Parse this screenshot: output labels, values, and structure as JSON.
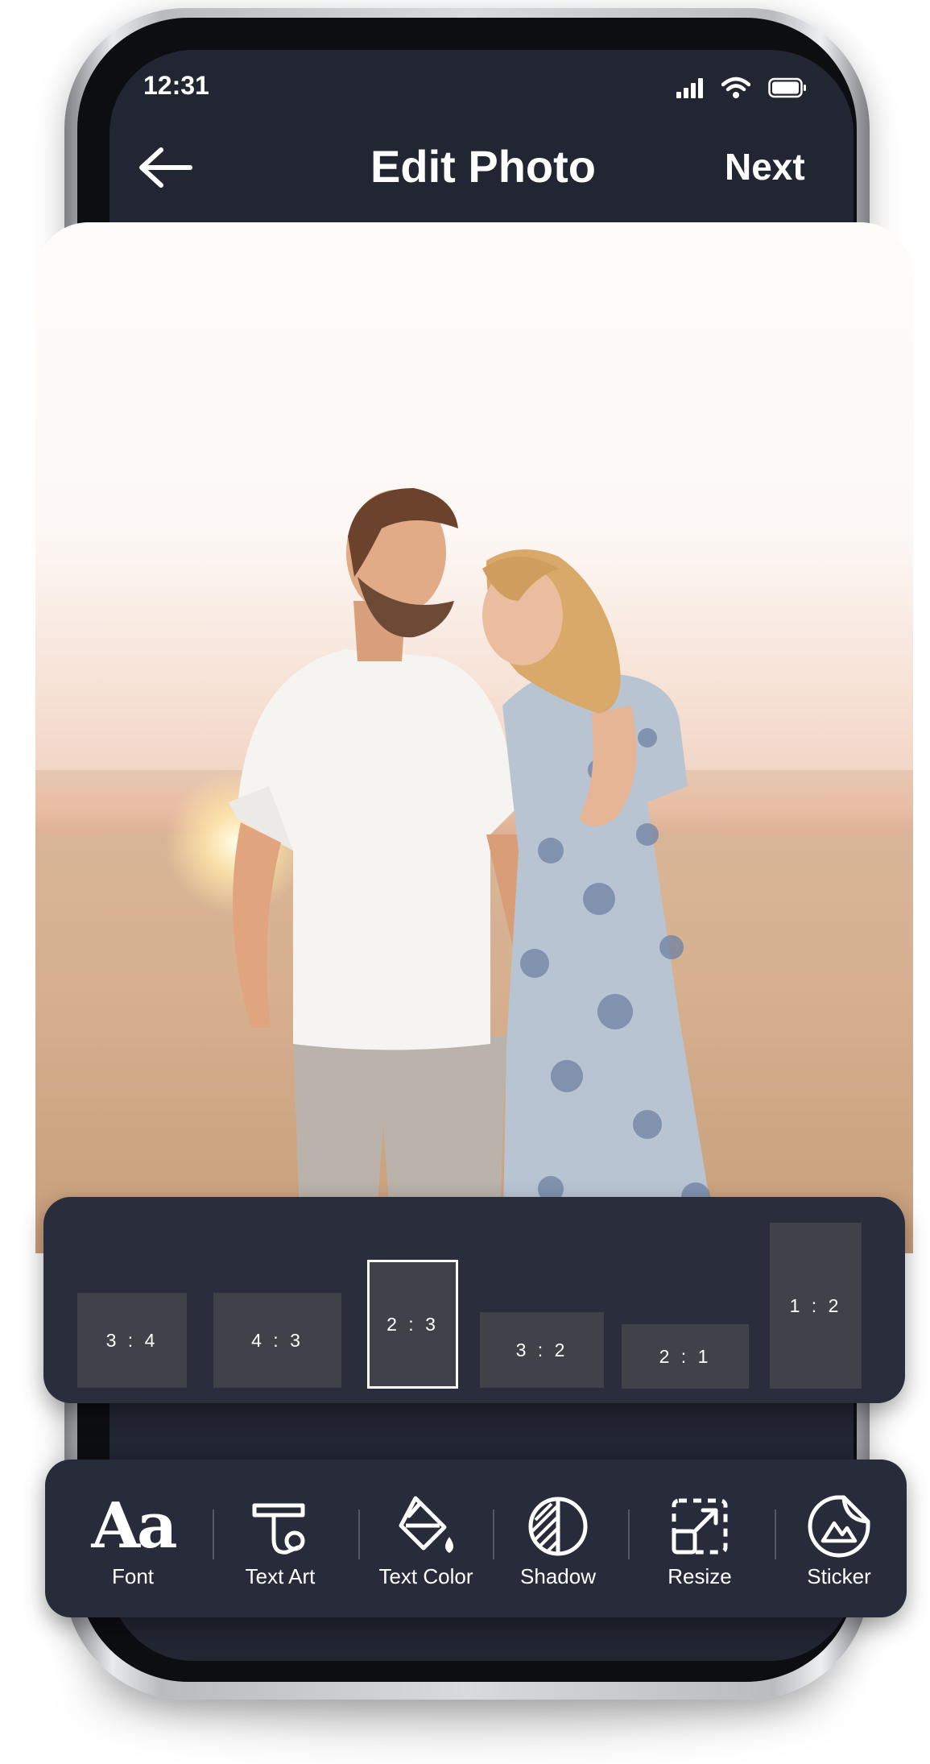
{
  "status_bar": {
    "time": "12:31"
  },
  "nav": {
    "title": "Edit Photo",
    "next_label": "Next"
  },
  "aspect_ratios": [
    {
      "label": "3 : 4",
      "selected": false
    },
    {
      "label": "4 : 3",
      "selected": false
    },
    {
      "label": "2 : 3",
      "selected": true
    },
    {
      "label": "3 : 2",
      "selected": false
    },
    {
      "label": "2 : 1",
      "selected": false
    },
    {
      "label": "1 : 2",
      "selected": false
    }
  ],
  "tools": [
    {
      "label": "Font",
      "icon": "font-icon",
      "glyph": "Aa"
    },
    {
      "label": "Text Art",
      "icon": "text-art-icon"
    },
    {
      "label": "Text Color",
      "icon": "paint-bucket-icon"
    },
    {
      "label": "Shadow",
      "icon": "shadow-icon"
    },
    {
      "label": "Resize",
      "icon": "resize-icon"
    },
    {
      "label": "Sticker",
      "icon": "sticker-icon"
    }
  ],
  "colors": {
    "panel": "#282b39",
    "screen": "#222532",
    "ratio_box": "#3f4249",
    "text": "#ffffff"
  }
}
